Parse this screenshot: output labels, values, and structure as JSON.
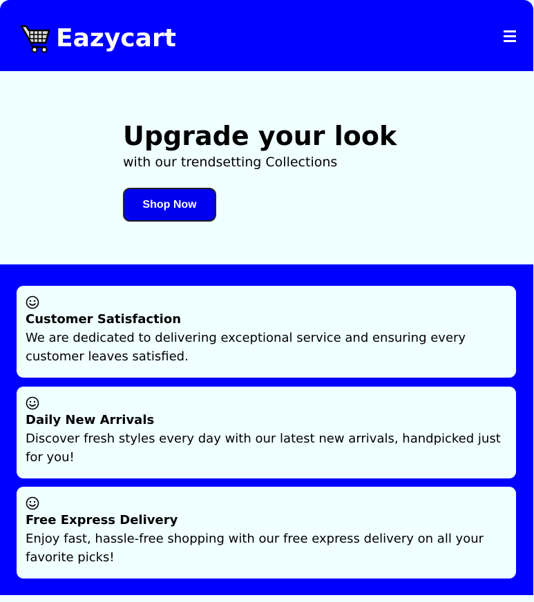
{
  "header": {
    "brand": "Eazycart",
    "logo_icon": "shopping-cart-icon",
    "menu_icon": "hamburger-menu-icon",
    "background": "#0000ff"
  },
  "hero": {
    "title": "Upgrade your look",
    "subtitle": "with our trendsetting Collections",
    "cta_label": "Shop Now",
    "background": "#f0ffff"
  },
  "features": {
    "background": "#0000ff",
    "items": [
      {
        "icon": "smiley-icon",
        "title": "Customer Satisfaction",
        "text": "We are dedicated to delivering exceptional service and ensuring every customer leaves satisfied."
      },
      {
        "icon": "smiley-icon",
        "title": "Daily New Arrivals",
        "text": "Discover fresh styles every day with our latest new arrivals, handpicked just for you!"
      },
      {
        "icon": "smiley-icon",
        "title": "Free Express Delivery",
        "text": "Enjoy fast, hassle-free shopping with our free express delivery on all your favorite picks!"
      }
    ]
  }
}
